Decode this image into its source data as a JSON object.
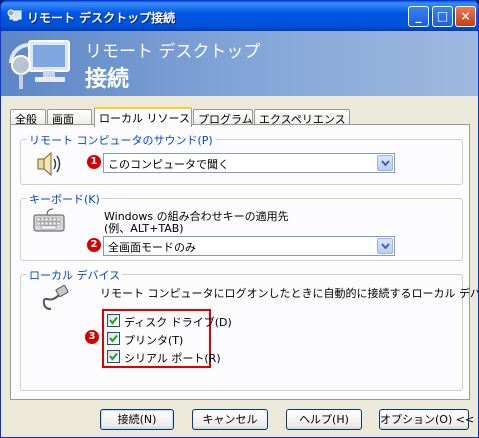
{
  "window": {
    "title": "リモート デスクトップ接続",
    "minimize": "_",
    "maximize": "□",
    "close": "×"
  },
  "banner": {
    "line1": "リモート デスクトップ",
    "line2": "接続"
  },
  "tabs": [
    {
      "label": "全般"
    },
    {
      "label": "画面"
    },
    {
      "label": "ローカル リソース",
      "active": true
    },
    {
      "label": "プログラム"
    },
    {
      "label": "エクスペリエンス"
    }
  ],
  "sound": {
    "legend": "リモート コンピュータのサウンド(P)",
    "badge": "1",
    "selected": "このコンピュータで聞く"
  },
  "keyboard": {
    "legend": "キーボード(K)",
    "desc1": "Windows の組み合わせキーの適用先",
    "desc2": "(例、ALT+TAB)",
    "badge": "2",
    "selected": "全画面モードのみ"
  },
  "local_devices": {
    "legend": "ローカル デバイス",
    "desc": "リモート コンピュータにログオンしたときに自動的に接続するローカル デバイス:",
    "badge": "3",
    "items": [
      {
        "label": "ディスク ドライブ(D)",
        "checked": true
      },
      {
        "label": "プリンタ(T)",
        "checked": true
      },
      {
        "label": "シリアル ポート(R)",
        "checked": true
      }
    ]
  },
  "buttons": {
    "connect": "接続(N)",
    "cancel": "キャンセル",
    "help": "ヘルプ(H)",
    "options": "オプション(O) <<"
  },
  "colors": {
    "title_bar": "#0058e6",
    "legend_text": "#0046d5",
    "badge": "#d40000",
    "highlight_box": "#e00000"
  }
}
